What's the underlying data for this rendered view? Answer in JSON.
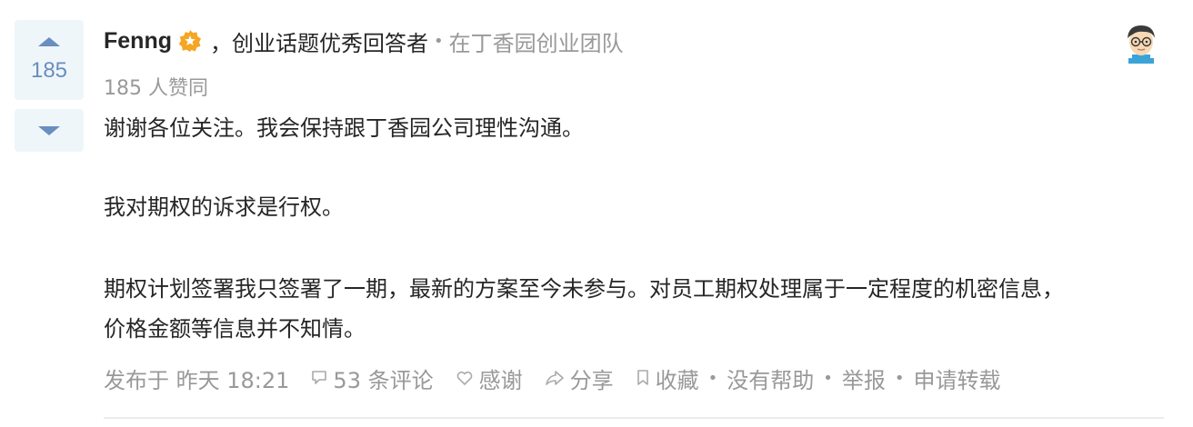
{
  "vote": {
    "count": "185"
  },
  "author": {
    "name": "Fenng",
    "badge_icon": "verified-star-badge",
    "bio": "，创业话题优秀回答者",
    "separator": "•",
    "org": "在丁香园创业团队"
  },
  "likes": "185 人赞同",
  "content": {
    "paragraphs": [
      "谢谢各位关注。我会保持跟丁香园公司理性沟通。",
      "我对期权的诉求是行权。",
      "期权计划签署我只签署了一期，最新的方案至今未参与。对员工期权处理属于一定程度的机密信息，",
      "价格金额等信息并不知情。"
    ]
  },
  "actions": {
    "published": "发布于 昨天 18:21",
    "comments": "53 条评论",
    "thanks": "感谢",
    "share": "分享",
    "collect": "收藏",
    "unhelpful": "没有帮助",
    "report": "举报",
    "transfer": "申请转载",
    "dot": "•"
  },
  "colors": {
    "vote_bg": "#eff6fa",
    "vote_accent": "#698ebf",
    "text": "#262626",
    "muted": "#999999",
    "badge": "#f5a623"
  }
}
